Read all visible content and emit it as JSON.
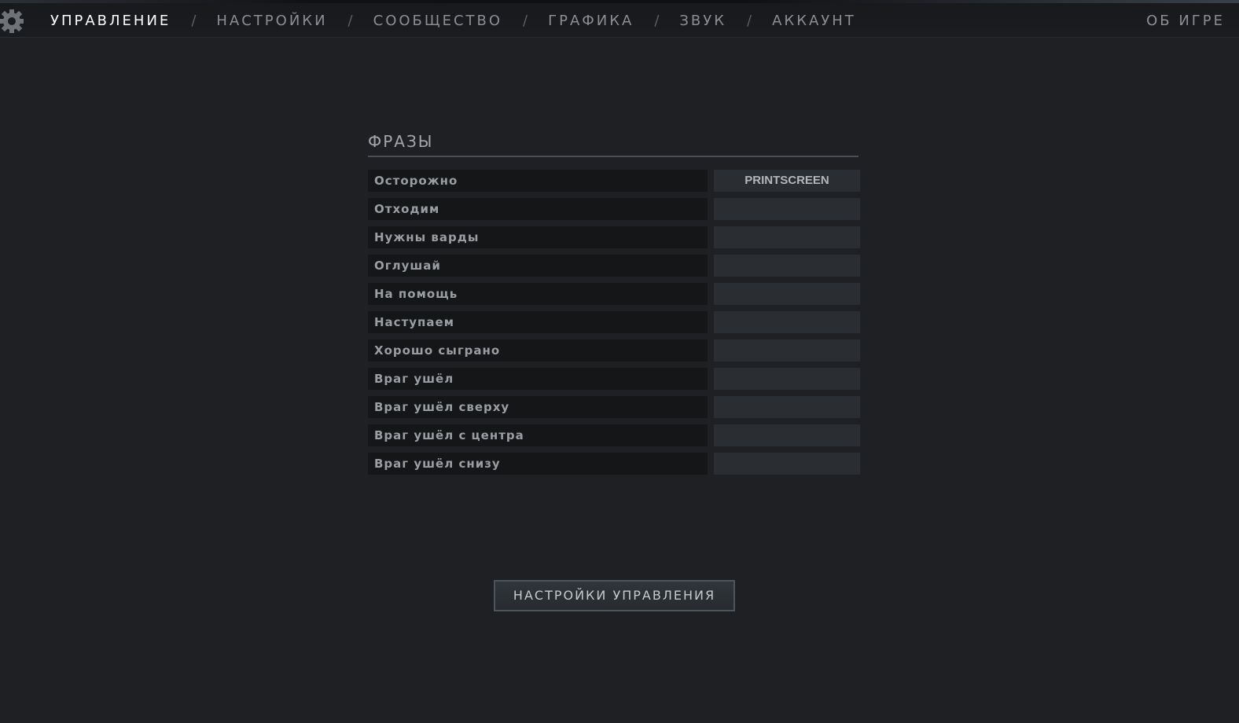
{
  "nav": {
    "items": [
      {
        "label": "УПРАВЛЕНИЕ",
        "active": true
      },
      {
        "label": "НАСТРОЙКИ",
        "active": false
      },
      {
        "label": "СООБЩЕСТВО",
        "active": false
      },
      {
        "label": "ГРАФИКА",
        "active": false
      },
      {
        "label": "ЗВУК",
        "active": false
      },
      {
        "label": "АККАУНТ",
        "active": false
      }
    ],
    "separator": "/",
    "about_label": "ОБ ИГРЕ",
    "settings_icon": "gear-icon"
  },
  "phrases": {
    "title": "ФРАЗЫ",
    "rows": [
      {
        "label": "Осторожно",
        "key": "PRINTSCREEN"
      },
      {
        "label": "Отходим",
        "key": ""
      },
      {
        "label": "Нужны варды",
        "key": ""
      },
      {
        "label": "Оглушай",
        "key": ""
      },
      {
        "label": "На помощь",
        "key": ""
      },
      {
        "label": "Наступаем",
        "key": ""
      },
      {
        "label": "Хорошо сыграно",
        "key": ""
      },
      {
        "label": "Враг ушёл",
        "key": ""
      },
      {
        "label": "Враг ушёл сверху",
        "key": ""
      },
      {
        "label": "Враг ушёл с центра",
        "key": ""
      },
      {
        "label": "Враг ушёл снизу",
        "key": ""
      }
    ]
  },
  "footer": {
    "control_settings_label": "НАСТРОЙКИ УПРАВЛЕНИЯ"
  },
  "colors": {
    "background": "#1e2024",
    "active_nav": "#ffffff",
    "inactive_nav": "#8a8e93",
    "label_bg": "#141618",
    "key_bg": "#2a2d31"
  }
}
